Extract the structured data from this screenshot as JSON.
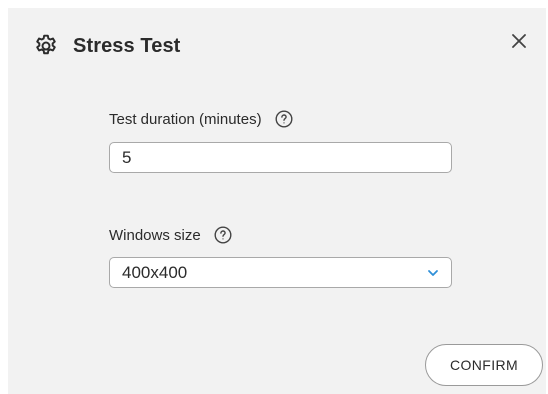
{
  "dialog": {
    "title": "Stress Test",
    "title_icon": "gear-icon",
    "close_icon": "close-icon"
  },
  "fields": {
    "duration": {
      "label": "Test duration (minutes)",
      "help_icon": "help-icon",
      "value": "5"
    },
    "window_size": {
      "label": "Windows size",
      "help_icon": "help-icon",
      "selected": "400x400",
      "chevron_icon": "chevron-down-icon",
      "chevron_color": "#2f8fd8"
    }
  },
  "actions": {
    "confirm_label": "CONFIRM"
  }
}
